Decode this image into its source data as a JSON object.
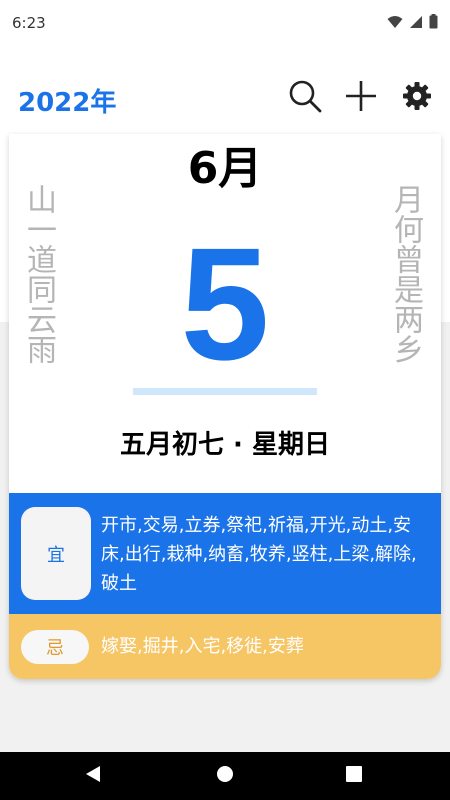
{
  "status_bar": {
    "time": "6:23"
  },
  "app_bar": {
    "year_title": "2022年",
    "icons": [
      "search-icon",
      "add-icon",
      "gear-icon"
    ]
  },
  "calendar": {
    "month": "6月",
    "day": "5",
    "lunar_weekday": "五月初七 · 星期日",
    "left_poem": "山一道同云雨",
    "right_poem": "月何曾是两乡"
  },
  "yi": {
    "badge": "宜",
    "items": "开市,交易,立券,祭祀,祈福,开光,动土,安床,出行,栽种,纳畜,牧养,竖柱,上梁,解除,破土"
  },
  "ji": {
    "badge": "忌",
    "items": "嫁娶,掘井,入宅,移徙,安葬"
  },
  "colors": {
    "accent": "#1a73e8",
    "ji_bg": "#f6c564",
    "poem_gray": "#b5b5b5"
  }
}
